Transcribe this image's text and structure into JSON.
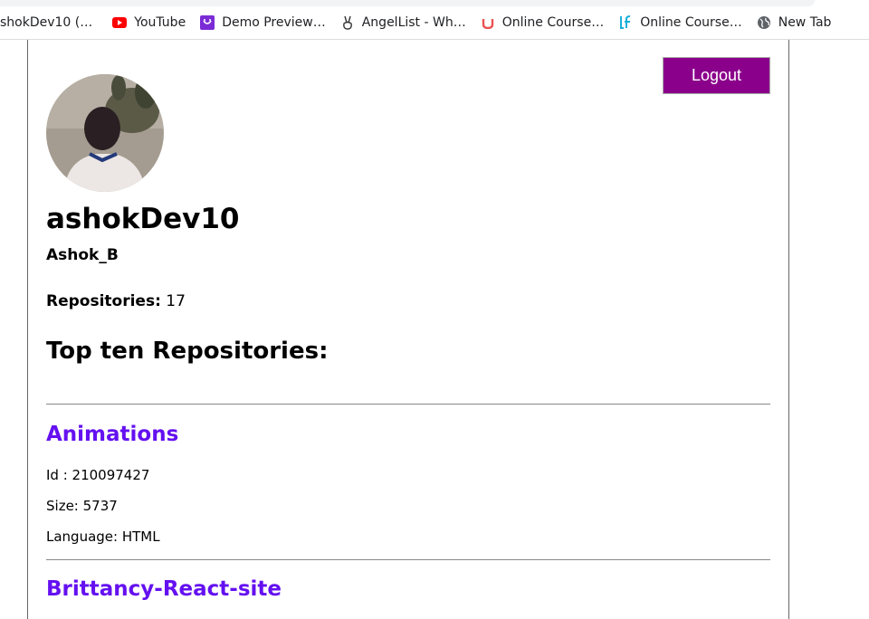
{
  "bookmarks": [
    {
      "label": "shokDev10 (…",
      "icon": "github-icon"
    },
    {
      "label": "YouTube",
      "icon": "youtube-icon"
    },
    {
      "label": "Demo Preview…",
      "icon": "demo-preview-icon"
    },
    {
      "label": "AngelList - Wh…",
      "icon": "angellist-icon"
    },
    {
      "label": "Online Course…",
      "icon": "udemy-icon"
    },
    {
      "label": "Online Course…",
      "icon": "linux-foundation-icon"
    },
    {
      "label": "New Tab",
      "icon": "globe-icon"
    }
  ],
  "header": {
    "logout_label": "Logout"
  },
  "profile": {
    "username": "ashokDev10",
    "full_name": "Ashok_B",
    "repositories_label": "Repositories:",
    "repositories_count": "17"
  },
  "top_heading": "Top ten Repositories:",
  "repos": [
    {
      "name": "Animations",
      "id_text": "Id : 210097427",
      "size_text": "Size: 5737",
      "language_text": "Language: HTML"
    },
    {
      "name": "Brittancy-React-site"
    }
  ],
  "colors": {
    "accent": "#8b008b",
    "link": "#6410f0"
  }
}
